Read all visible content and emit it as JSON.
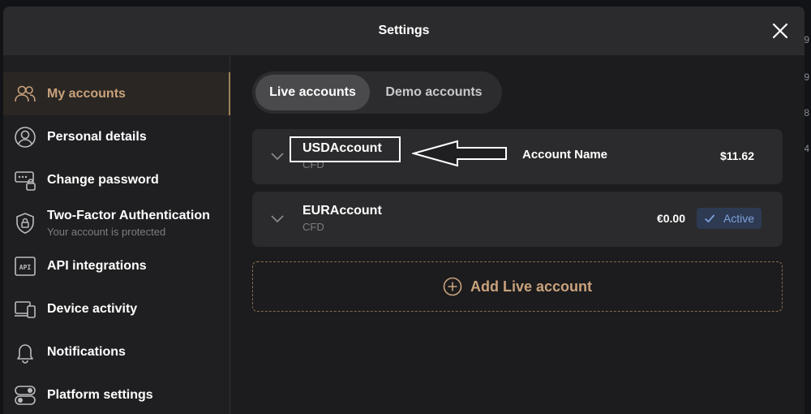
{
  "modal": {
    "title": "Settings"
  },
  "sidebar": {
    "items": [
      {
        "label": "My accounts",
        "icon": "users-icon"
      },
      {
        "label": "Personal details",
        "icon": "user-circle-icon"
      },
      {
        "label": "Change password",
        "icon": "password-lock-icon"
      },
      {
        "label": "Two-Factor Authentication",
        "sub": "Your account is protected",
        "icon": "shield-lock-icon"
      },
      {
        "label": "API integrations",
        "icon": "api-icon"
      },
      {
        "label": "Device activity",
        "icon": "devices-icon"
      },
      {
        "label": "Notifications",
        "icon": "bell-icon"
      },
      {
        "label": "Platform settings",
        "icon": "toggles-icon"
      }
    ]
  },
  "tabs": {
    "live": "Live accounts",
    "demo": "Demo accounts"
  },
  "accounts": [
    {
      "name": "USDAccount",
      "type": "CFD",
      "balance": "$11.62"
    },
    {
      "name": "EURAccount",
      "type": "CFD",
      "balance": "€0.00",
      "badge": "Active"
    }
  ],
  "annotation": {
    "label": "Account Name"
  },
  "add_button": {
    "label": "Add Live account"
  },
  "backdrop": {
    "edge_numbers": [
      "9",
      "9",
      "8",
      "4"
    ]
  },
  "colors": {
    "accent": "#c9a27c",
    "active_badge": "#7ea1dd"
  }
}
